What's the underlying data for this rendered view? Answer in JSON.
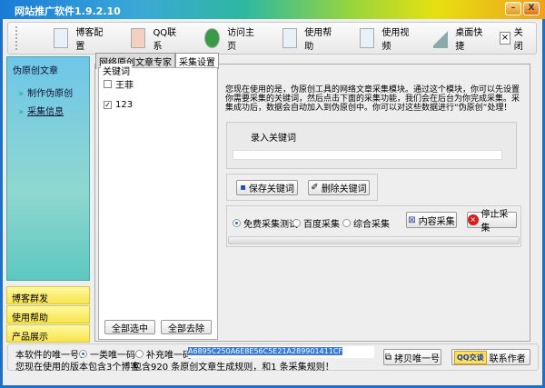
{
  "window": {
    "title": "网站推广软件1.9.2.10",
    "min": "–",
    "close": "X"
  },
  "toolbar": [
    {
      "label": "博客配置",
      "icon": "blog-config-icon"
    },
    {
      "label": "QQ联系",
      "icon": "qq-contact-icon"
    },
    {
      "label": "访问主页",
      "icon": "globe-icon"
    },
    {
      "label": "使用帮助",
      "icon": "help-icon"
    },
    {
      "label": "使用视频",
      "icon": "video-icon"
    },
    {
      "label": "桌面快捷",
      "icon": "shortcut-icon"
    }
  ],
  "toolbar_close": "关闭",
  "sidebar": {
    "section": "伪原创文章",
    "items": [
      "制作伪原创",
      "采集信息"
    ],
    "bottom": [
      "博客群发",
      "使用帮助",
      "产品展示"
    ]
  },
  "tabs": [
    "网络原创文章专家",
    "采集设置"
  ],
  "keywords": {
    "legend": "关键词",
    "items": [
      {
        "label": "王菲",
        "checked": false
      },
      {
        "label": "123",
        "checked": true
      }
    ],
    "select_all": "全部选中",
    "clear_all": "全部去除"
  },
  "description": "您现在使用的是，伪原创工具的网络文章采集模块。通过这个模块，你可以先设置你需要采集的关键词，然后点击下面的采集功能，我们会在后台为你完成采集。采集成功后，数据会自动加入到伪原创中。你可以对这些数据进行“伪原创”处理！",
  "input": {
    "label": "录入关键词",
    "value": ""
  },
  "buttons": {
    "save": "保存关键词",
    "delete": "删除关键词",
    "collect": "内容采集",
    "stop": "停止采集"
  },
  "modes": [
    {
      "label": "免费采集测试",
      "selected": true
    },
    {
      "label": "百度采集",
      "selected": false
    },
    {
      "label": "综合采集",
      "selected": false
    }
  ],
  "progress": 0,
  "footer": {
    "id_label": "本软件的唯一号：",
    "id_options": [
      {
        "label": "一类唯一码",
        "selected": true
      },
      {
        "label": "补充唯一码",
        "selected": false
      }
    ],
    "id_value": "A6895C250A6E8E56C5E21A289901411CF",
    "copy": "拷贝唯一号",
    "qq": "QQ交谈",
    "contact": "联系作者",
    "blog_count": "您现在使用的版本包含3个博客",
    "rules": "包含920 条原创文章生成规则，和1 条采集规则！"
  }
}
